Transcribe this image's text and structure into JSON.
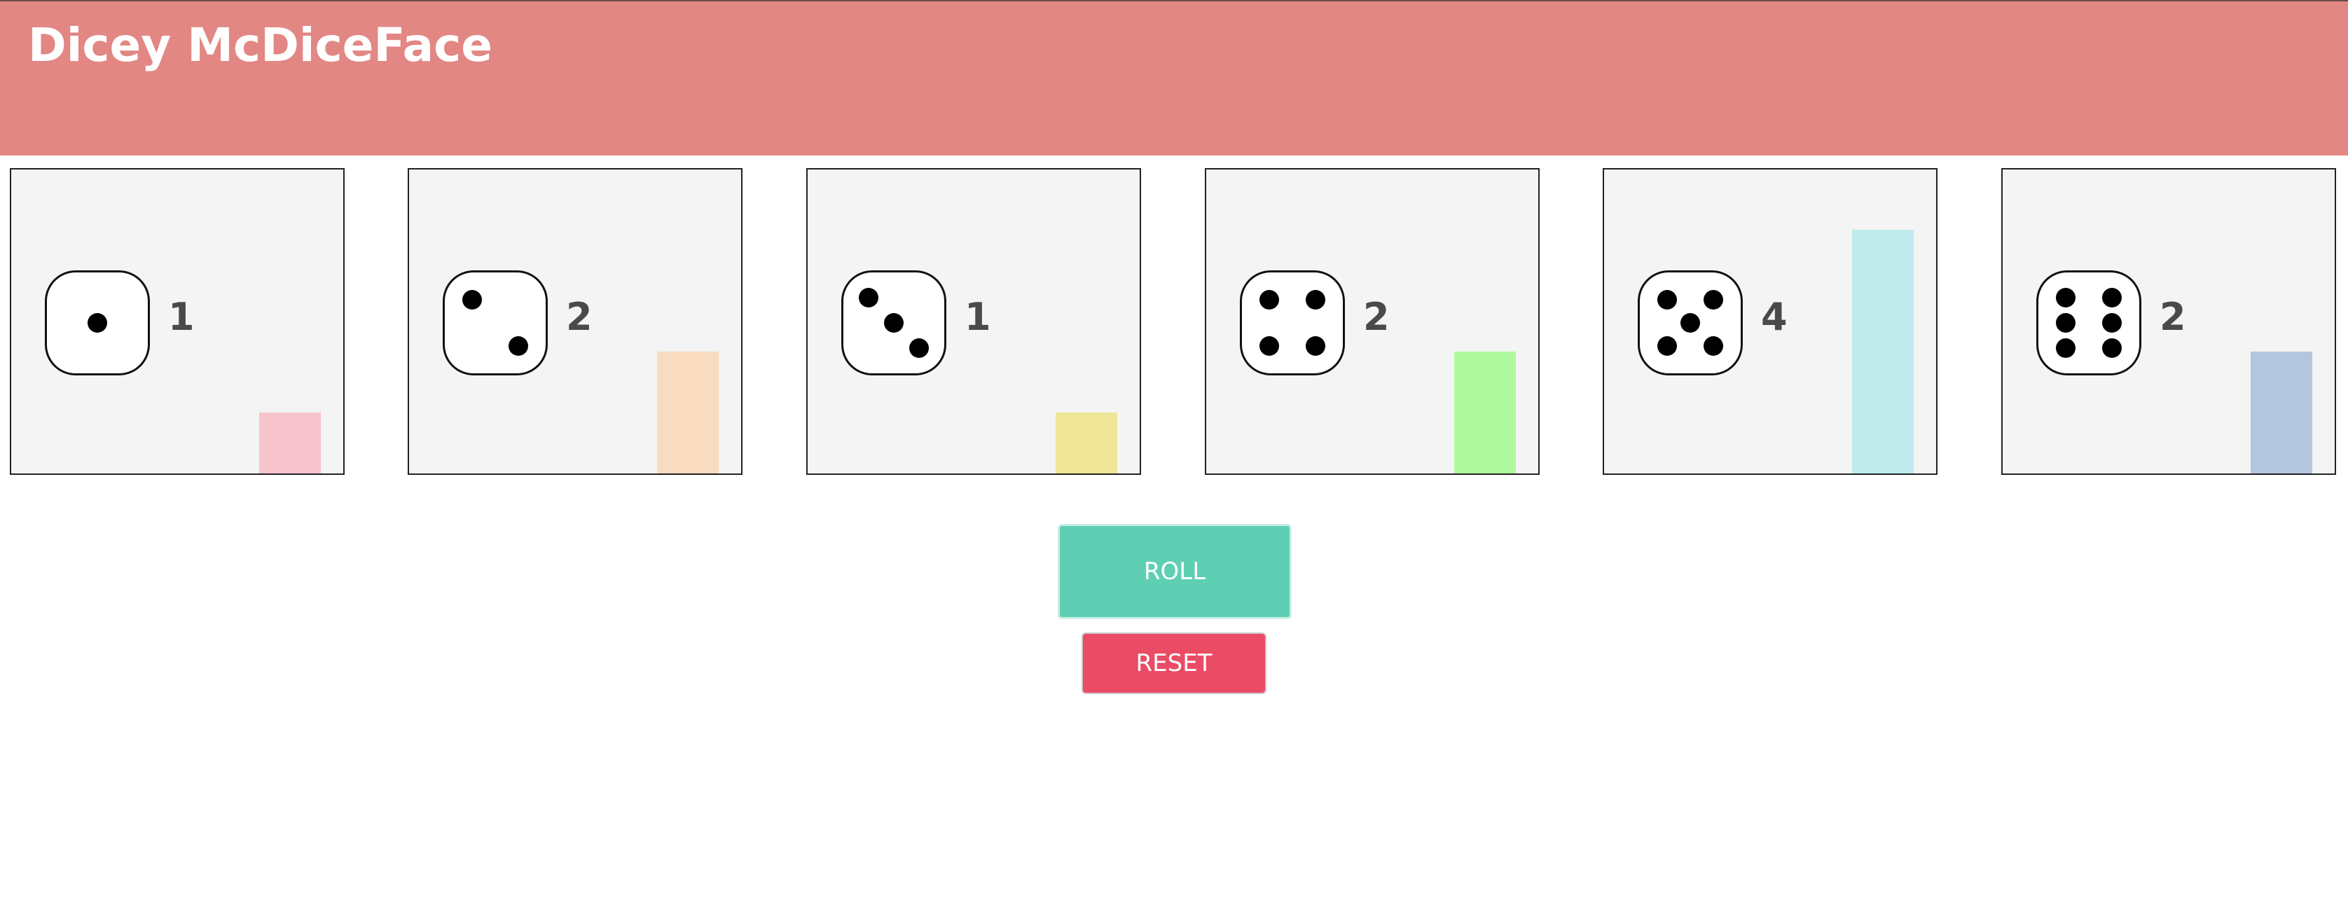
{
  "app": {
    "title": "Dicey McDiceFace"
  },
  "dice": [
    {
      "face": 1,
      "count": "1",
      "bar_level": 1,
      "bar_color": "#f7c4cd"
    },
    {
      "face": 2,
      "count": "2",
      "bar_level": 2,
      "bar_color": "#f9dcc0"
    },
    {
      "face": 3,
      "count": "1",
      "bar_level": 1,
      "bar_color": "#efe597"
    },
    {
      "face": 4,
      "count": "2",
      "bar_level": 2,
      "bar_color": "#affa9e"
    },
    {
      "face": 5,
      "count": "4",
      "bar_level": 4,
      "bar_color": "#c0ebed"
    },
    {
      "face": 6,
      "count": "2",
      "bar_level": 2,
      "bar_color": "#b4c5de"
    }
  ],
  "buttons": {
    "roll_label": "ROLL",
    "reset_label": "RESET"
  },
  "colors": {
    "header": "#e28784",
    "panel": "#f4f4f4",
    "roll": "#5ecfb3",
    "reset": "#ea4b65"
  }
}
